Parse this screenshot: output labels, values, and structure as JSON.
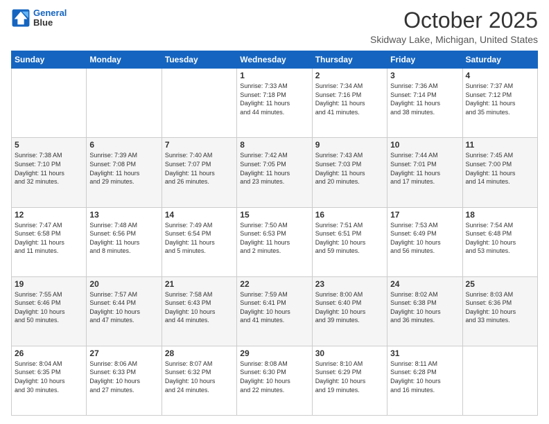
{
  "header": {
    "logo_line1": "General",
    "logo_line2": "Blue",
    "month": "October 2025",
    "location": "Skidway Lake, Michigan, United States"
  },
  "days_of_week": [
    "Sunday",
    "Monday",
    "Tuesday",
    "Wednesday",
    "Thursday",
    "Friday",
    "Saturday"
  ],
  "weeks": [
    [
      {
        "day": "",
        "info": ""
      },
      {
        "day": "",
        "info": ""
      },
      {
        "day": "",
        "info": ""
      },
      {
        "day": "1",
        "info": "Sunrise: 7:33 AM\nSunset: 7:18 PM\nDaylight: 11 hours\nand 44 minutes."
      },
      {
        "day": "2",
        "info": "Sunrise: 7:34 AM\nSunset: 7:16 PM\nDaylight: 11 hours\nand 41 minutes."
      },
      {
        "day": "3",
        "info": "Sunrise: 7:36 AM\nSunset: 7:14 PM\nDaylight: 11 hours\nand 38 minutes."
      },
      {
        "day": "4",
        "info": "Sunrise: 7:37 AM\nSunset: 7:12 PM\nDaylight: 11 hours\nand 35 minutes."
      }
    ],
    [
      {
        "day": "5",
        "info": "Sunrise: 7:38 AM\nSunset: 7:10 PM\nDaylight: 11 hours\nand 32 minutes."
      },
      {
        "day": "6",
        "info": "Sunrise: 7:39 AM\nSunset: 7:08 PM\nDaylight: 11 hours\nand 29 minutes."
      },
      {
        "day": "7",
        "info": "Sunrise: 7:40 AM\nSunset: 7:07 PM\nDaylight: 11 hours\nand 26 minutes."
      },
      {
        "day": "8",
        "info": "Sunrise: 7:42 AM\nSunset: 7:05 PM\nDaylight: 11 hours\nand 23 minutes."
      },
      {
        "day": "9",
        "info": "Sunrise: 7:43 AM\nSunset: 7:03 PM\nDaylight: 11 hours\nand 20 minutes."
      },
      {
        "day": "10",
        "info": "Sunrise: 7:44 AM\nSunset: 7:01 PM\nDaylight: 11 hours\nand 17 minutes."
      },
      {
        "day": "11",
        "info": "Sunrise: 7:45 AM\nSunset: 7:00 PM\nDaylight: 11 hours\nand 14 minutes."
      }
    ],
    [
      {
        "day": "12",
        "info": "Sunrise: 7:47 AM\nSunset: 6:58 PM\nDaylight: 11 hours\nand 11 minutes."
      },
      {
        "day": "13",
        "info": "Sunrise: 7:48 AM\nSunset: 6:56 PM\nDaylight: 11 hours\nand 8 minutes."
      },
      {
        "day": "14",
        "info": "Sunrise: 7:49 AM\nSunset: 6:54 PM\nDaylight: 11 hours\nand 5 minutes."
      },
      {
        "day": "15",
        "info": "Sunrise: 7:50 AM\nSunset: 6:53 PM\nDaylight: 11 hours\nand 2 minutes."
      },
      {
        "day": "16",
        "info": "Sunrise: 7:51 AM\nSunset: 6:51 PM\nDaylight: 10 hours\nand 59 minutes."
      },
      {
        "day": "17",
        "info": "Sunrise: 7:53 AM\nSunset: 6:49 PM\nDaylight: 10 hours\nand 56 minutes."
      },
      {
        "day": "18",
        "info": "Sunrise: 7:54 AM\nSunset: 6:48 PM\nDaylight: 10 hours\nand 53 minutes."
      }
    ],
    [
      {
        "day": "19",
        "info": "Sunrise: 7:55 AM\nSunset: 6:46 PM\nDaylight: 10 hours\nand 50 minutes."
      },
      {
        "day": "20",
        "info": "Sunrise: 7:57 AM\nSunset: 6:44 PM\nDaylight: 10 hours\nand 47 minutes."
      },
      {
        "day": "21",
        "info": "Sunrise: 7:58 AM\nSunset: 6:43 PM\nDaylight: 10 hours\nand 44 minutes."
      },
      {
        "day": "22",
        "info": "Sunrise: 7:59 AM\nSunset: 6:41 PM\nDaylight: 10 hours\nand 41 minutes."
      },
      {
        "day": "23",
        "info": "Sunrise: 8:00 AM\nSunset: 6:40 PM\nDaylight: 10 hours\nand 39 minutes."
      },
      {
        "day": "24",
        "info": "Sunrise: 8:02 AM\nSunset: 6:38 PM\nDaylight: 10 hours\nand 36 minutes."
      },
      {
        "day": "25",
        "info": "Sunrise: 8:03 AM\nSunset: 6:36 PM\nDaylight: 10 hours\nand 33 minutes."
      }
    ],
    [
      {
        "day": "26",
        "info": "Sunrise: 8:04 AM\nSunset: 6:35 PM\nDaylight: 10 hours\nand 30 minutes."
      },
      {
        "day": "27",
        "info": "Sunrise: 8:06 AM\nSunset: 6:33 PM\nDaylight: 10 hours\nand 27 minutes."
      },
      {
        "day": "28",
        "info": "Sunrise: 8:07 AM\nSunset: 6:32 PM\nDaylight: 10 hours\nand 24 minutes."
      },
      {
        "day": "29",
        "info": "Sunrise: 8:08 AM\nSunset: 6:30 PM\nDaylight: 10 hours\nand 22 minutes."
      },
      {
        "day": "30",
        "info": "Sunrise: 8:10 AM\nSunset: 6:29 PM\nDaylight: 10 hours\nand 19 minutes."
      },
      {
        "day": "31",
        "info": "Sunrise: 8:11 AM\nSunset: 6:28 PM\nDaylight: 10 hours\nand 16 minutes."
      },
      {
        "day": "",
        "info": ""
      }
    ]
  ]
}
